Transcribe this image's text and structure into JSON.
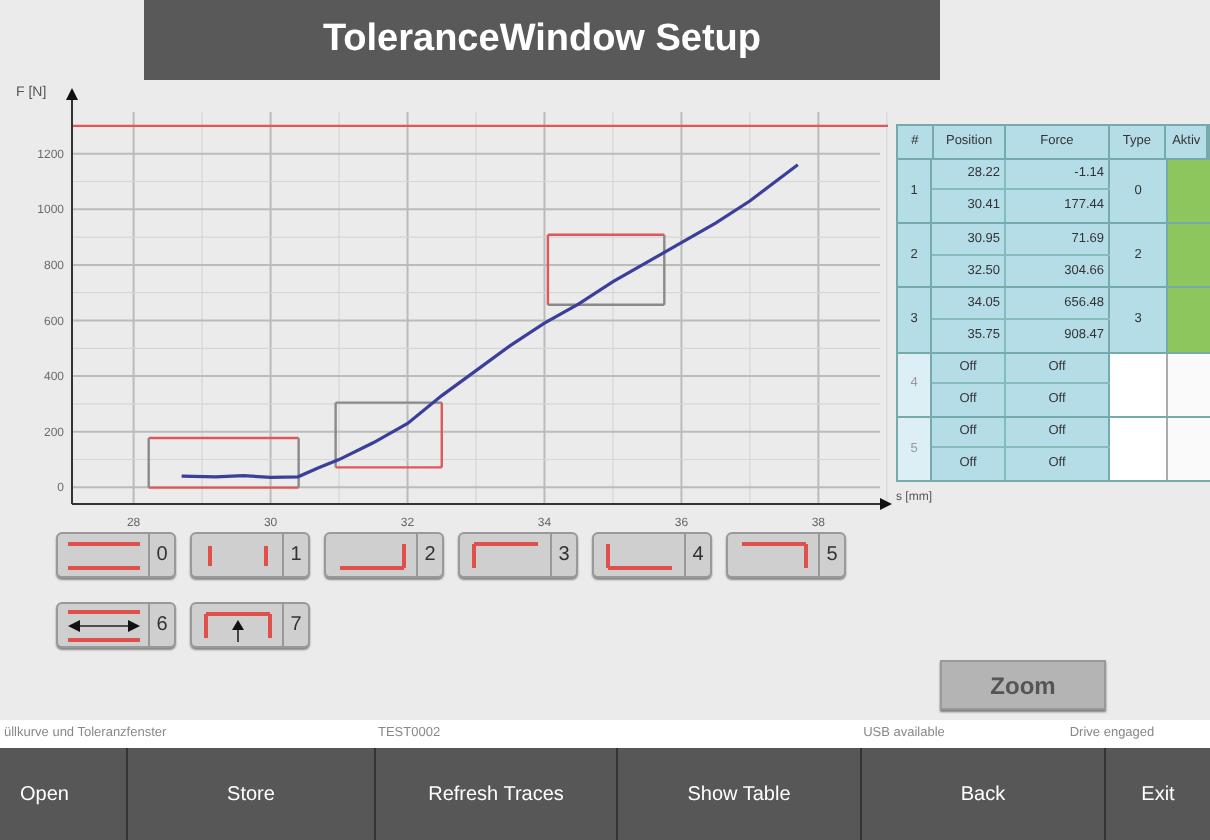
{
  "title": "ToleranceWindow Setup",
  "chart": {
    "chart_data": {
      "type": "line",
      "xlabel": "s [mm]",
      "ylabel": "F [N]",
      "xlim": [
        27.1,
        38.9
      ],
      "ylim": [
        -60,
        1350
      ],
      "xticks": [
        28,
        30,
        32,
        34,
        36,
        38
      ],
      "yticks": [
        {
          "value": 0,
          "label": "0"
        },
        {
          "value": 200,
          "label": "200"
        },
        {
          "value": 400,
          "label": "400"
        },
        {
          "value": 600,
          "label": "600"
        },
        {
          "value": 800,
          "label": "800"
        },
        {
          "value": 1000,
          "label": "1000"
        },
        {
          "value": 1200,
          "label": "1200"
        }
      ],
      "series": [
        {
          "color": "#3a3f9a",
          "x": [
            28.7,
            29.2,
            29.6,
            30.0,
            30.4,
            30.7,
            31.0,
            31.5,
            32.0,
            32.5,
            33.0,
            33.5,
            34.0,
            34.5,
            35.0,
            35.5,
            36.0,
            36.5,
            37.0,
            37.7
          ],
          "values": [
            40,
            38,
            42,
            36,
            38,
            70,
            100,
            160,
            230,
            330,
            420,
            510,
            590,
            660,
            740,
            810,
            880,
            950,
            1030,
            1160
          ]
        }
      ],
      "grid": true,
      "ref_lines": [
        {
          "axis": "y",
          "value": 1300,
          "color": "#e0575a"
        }
      ]
    }
  },
  "table": {
    "columns": [
      "#",
      "Position",
      "Force",
      "Type",
      "Aktiv"
    ],
    "windows": [
      {
        "index": "1",
        "active": true,
        "type": "0",
        "kind": "top-bottom",
        "rows": [
          [
            "28.22",
            "-1.14"
          ],
          [
            "30.41",
            "177.44"
          ]
        ]
      },
      {
        "index": "2",
        "active": true,
        "type": "2",
        "kind": "bottom-right",
        "rows": [
          [
            "30.95",
            "71.69"
          ],
          [
            "32.50",
            "304.66"
          ]
        ]
      },
      {
        "index": "3",
        "active": true,
        "type": "3",
        "kind": "left-top",
        "rows": [
          [
            "34.05",
            "656.48"
          ],
          [
            "35.75",
            "908.47"
          ]
        ]
      },
      {
        "index": "4",
        "active": false,
        "rows": [
          [
            "Off",
            "Off"
          ],
          [
            "Off",
            "Off"
          ]
        ]
      },
      {
        "index": "5",
        "active": false,
        "rows": [
          [
            "Off",
            "Off"
          ],
          [
            "Off",
            "Off"
          ]
        ]
      }
    ]
  },
  "type_buttons": [
    {
      "label": "0",
      "kind": "top-bottom"
    },
    {
      "label": "1",
      "kind": "left-right"
    },
    {
      "label": "2",
      "kind": "bottom-right"
    },
    {
      "label": "3",
      "kind": "left-top"
    },
    {
      "label": "4",
      "kind": "left-bottom"
    },
    {
      "label": "5",
      "kind": "top-right"
    },
    {
      "label": "6",
      "kind": "through"
    },
    {
      "label": "7",
      "kind": "peak"
    }
  ],
  "zoom_button": "Zoom",
  "status_bar": [
    "üllkurve und Toleranzfenster",
    "TEST0002",
    "USB available",
    "Drive engaged"
  ],
  "toolbar": [
    "Open",
    "Store",
    "Refresh Traces",
    "Show Table",
    "Back",
    "Exit"
  ]
}
